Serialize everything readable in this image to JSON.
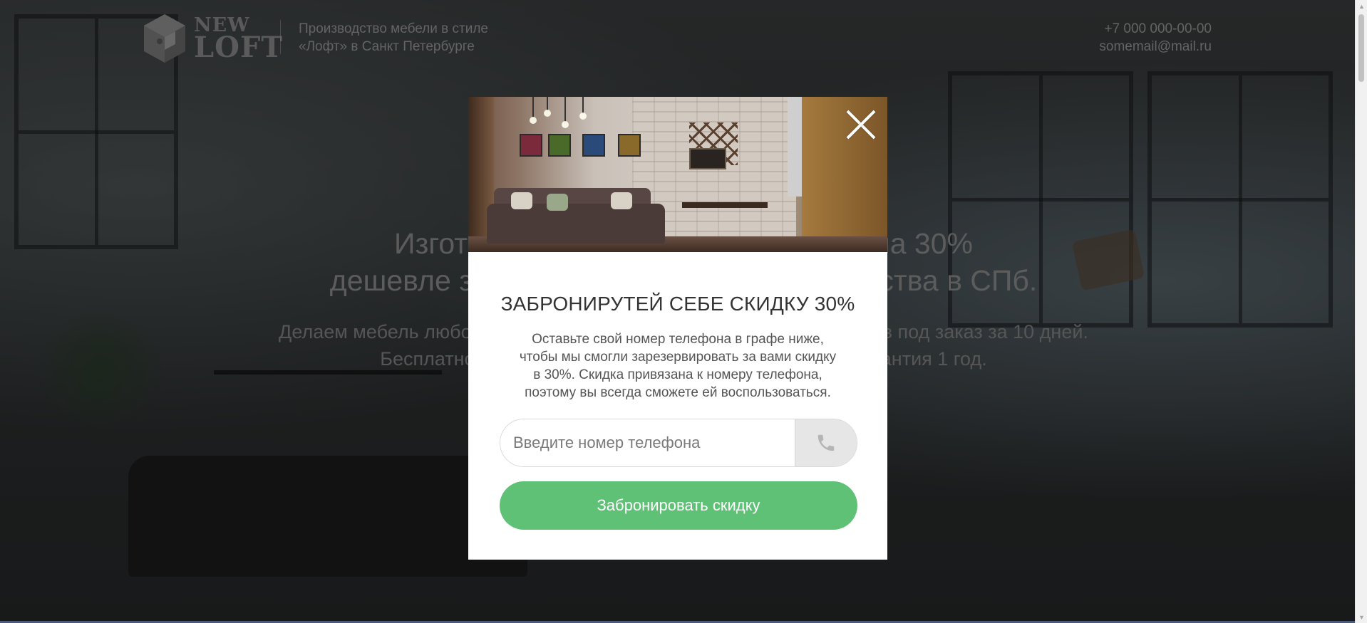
{
  "header": {
    "logo": {
      "line1": "NEW",
      "line2": "LOFT"
    },
    "tagline": [
      "Производство мебели в стиле",
      "«Лофт» в Санкт Петербурге"
    ],
    "phone": "+7 000 000-00-00",
    "email": "somemail@mail.ru"
  },
  "hero": {
    "title_line1": "Изготовим мебель в стиле «Лофт» на 30%",
    "title_line2": "дешевле за счет собственного производства в СПб.",
    "sub_line1": "Делаем мебель любой сложности и размеров для квартир и офисов под заказ за 10 дней.",
    "sub_line2": "Бесплатно доставим, соберем и установим мебель. Гарантия 1 год."
  },
  "modal": {
    "title": "ЗАБРОНИРУТЕЙ СЕБЕ СКИДКУ 30%",
    "text_line1": "Оставьте свой номер телефона в графе ниже,",
    "text_line2": "чтобы мы смогли зарезервировать за вами скидку",
    "text_line3": "в 30%. Скидка привязана к номеру телефона,",
    "text_line4": "поэтому вы всегда сможете ей воспользоваться.",
    "phone_placeholder": "Введите номер телефона",
    "phone_value": "",
    "submit_label": "Забронировать скидку",
    "close_icon": "close-icon",
    "phone_icon": "phone-icon"
  },
  "colors": {
    "accent_green": "#5fc176",
    "overlay": "rgba(0,0,0,0.35)",
    "modal_bg": "#ffffff"
  }
}
